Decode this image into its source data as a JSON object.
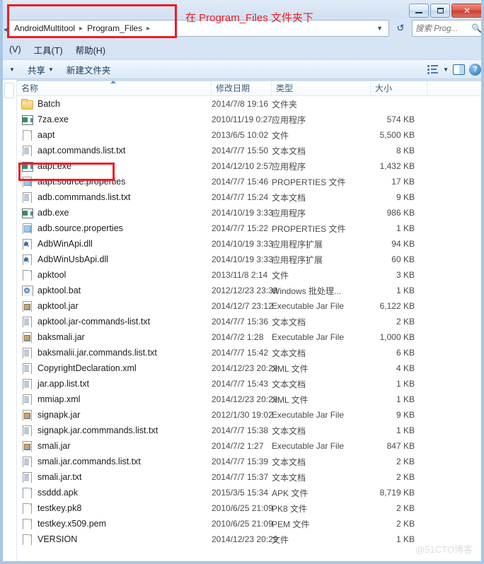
{
  "window": {
    "minimize_label": "—",
    "maximize_label": "□",
    "close_label": "✕"
  },
  "address_bar": {
    "crumbs": [
      "AndroidMultitool",
      "Program_Files"
    ],
    "separator": "▸",
    "dropdown_icon": "chevron-down",
    "refresh_icon": "refresh"
  },
  "search": {
    "placeholder": "搜索 Prog...",
    "icon": "search-icon"
  },
  "menu_bar": {
    "items": [
      "(V)",
      "工具(T)",
      "帮助(H)"
    ]
  },
  "toolbar": {
    "organize_caret": "▼",
    "items": [
      {
        "label": "共享",
        "caret": "▼"
      },
      {
        "label": "新建文件夹",
        "caret": ""
      }
    ],
    "view_caret": "▼",
    "help_label": "?"
  },
  "columns": {
    "name": "名称",
    "date": "修改日期",
    "type": "类型",
    "size": "大小"
  },
  "files": [
    {
      "name": "Batch",
      "icon": "folder",
      "date": "2014/7/8 19:16",
      "type": "文件夹",
      "size": ""
    },
    {
      "name": "7za.exe",
      "icon": "exe",
      "date": "2010/11/19 0:27",
      "type": "应用程序",
      "size": "574 KB"
    },
    {
      "name": "aapt",
      "icon": "file",
      "date": "2013/6/5 10:02",
      "type": "文件",
      "size": "5,500 KB"
    },
    {
      "name": "aapt.commands.list.txt",
      "icon": "txt",
      "date": "2014/7/7 15:50",
      "type": "文本文档",
      "size": "8 KB"
    },
    {
      "name": "aapt.exe",
      "icon": "exe",
      "date": "2014/12/10 2:57",
      "type": "应用程序",
      "size": "1,432 KB"
    },
    {
      "name": "aapt.source.properties",
      "icon": "prop",
      "date": "2014/7/7 15:46",
      "type": "PROPERTIES 文件",
      "size": "17 KB"
    },
    {
      "name": "adb.commmands.list.txt",
      "icon": "txt",
      "date": "2014/7/7 15:24",
      "type": "文本文档",
      "size": "9 KB"
    },
    {
      "name": "adb.exe",
      "icon": "exe",
      "date": "2014/10/19 3:33",
      "type": "应用程序",
      "size": "986 KB"
    },
    {
      "name": "adb.source.properties",
      "icon": "prop",
      "date": "2014/7/7 15:22",
      "type": "PROPERTIES 文件",
      "size": "1 KB"
    },
    {
      "name": "AdbWinApi.dll",
      "icon": "dll",
      "date": "2014/10/19 3:33",
      "type": "应用程序扩展",
      "size": "94 KB"
    },
    {
      "name": "AdbWinUsbApi.dll",
      "icon": "dll",
      "date": "2014/10/19 3:33",
      "type": "应用程序扩展",
      "size": "60 KB"
    },
    {
      "name": "apktool",
      "icon": "file",
      "date": "2013/11/8 2:14",
      "type": "文件",
      "size": "3 KB"
    },
    {
      "name": "apktool.bat",
      "icon": "bat",
      "date": "2012/12/23 23:39",
      "type": "Windows 批处理...",
      "size": "1 KB"
    },
    {
      "name": "apktool.jar",
      "icon": "jar",
      "date": "2014/12/7 23:12",
      "type": "Executable Jar File",
      "size": "6,122 KB"
    },
    {
      "name": "apktool.jar-commands-list.txt",
      "icon": "txt",
      "date": "2014/7/7 15:36",
      "type": "文本文档",
      "size": "2 KB"
    },
    {
      "name": "baksmali.jar",
      "icon": "jar",
      "date": "2014/7/2 1:28",
      "type": "Executable Jar File",
      "size": "1,000 KB"
    },
    {
      "name": "baksmalii.jar.commands.list.txt",
      "icon": "txt",
      "date": "2014/7/7 15:42",
      "type": "文本文档",
      "size": "6 KB"
    },
    {
      "name": "CopyrightDeclaration.xml",
      "icon": "txt",
      "date": "2014/12/23 20:29",
      "type": "XML 文件",
      "size": "4 KB"
    },
    {
      "name": "jar.app.list.txt",
      "icon": "txt",
      "date": "2014/7/7 15:43",
      "type": "文本文档",
      "size": "1 KB"
    },
    {
      "name": "mmiap.xml",
      "icon": "txt",
      "date": "2014/12/23 20:29",
      "type": "XML 文件",
      "size": "1 KB"
    },
    {
      "name": "signapk.jar",
      "icon": "jar",
      "date": "2012/1/30 19:02",
      "type": "Executable Jar File",
      "size": "9 KB"
    },
    {
      "name": "signapk.jar.commmands.list.txt",
      "icon": "txt",
      "date": "2014/7/7 15:38",
      "type": "文本文档",
      "size": "1 KB"
    },
    {
      "name": "smali.jar",
      "icon": "jar",
      "date": "2014/7/2 1:27",
      "type": "Executable Jar File",
      "size": "847 KB"
    },
    {
      "name": "smali.jar.commands.list.txt",
      "icon": "txt",
      "date": "2014/7/7 15:39",
      "type": "文本文档",
      "size": "2 KB"
    },
    {
      "name": "smali.jar.txt",
      "icon": "txt",
      "date": "2014/7/7 15:37",
      "type": "文本文档",
      "size": "2 KB"
    },
    {
      "name": "ssddd.apk",
      "icon": "file",
      "date": "2015/3/5 15:34",
      "type": "APK 文件",
      "size": "8,719 KB"
    },
    {
      "name": "testkey.pk8",
      "icon": "file",
      "date": "2010/6/25 21:09",
      "type": "PK8 文件",
      "size": "2 KB"
    },
    {
      "name": "testkey.x509.pem",
      "icon": "file",
      "date": "2010/6/25 21:09",
      "type": "PEM 文件",
      "size": "2 KB"
    },
    {
      "name": "VERSION",
      "icon": "file",
      "date": "2014/12/23 20:29",
      "type": "文件",
      "size": "1 KB"
    }
  ],
  "annotations": {
    "note_text": "在 Program_Files 文件夹下",
    "color": "#ee1c25",
    "highlighted_file": "aapt.exe"
  },
  "watermark": "@51CTO博客"
}
